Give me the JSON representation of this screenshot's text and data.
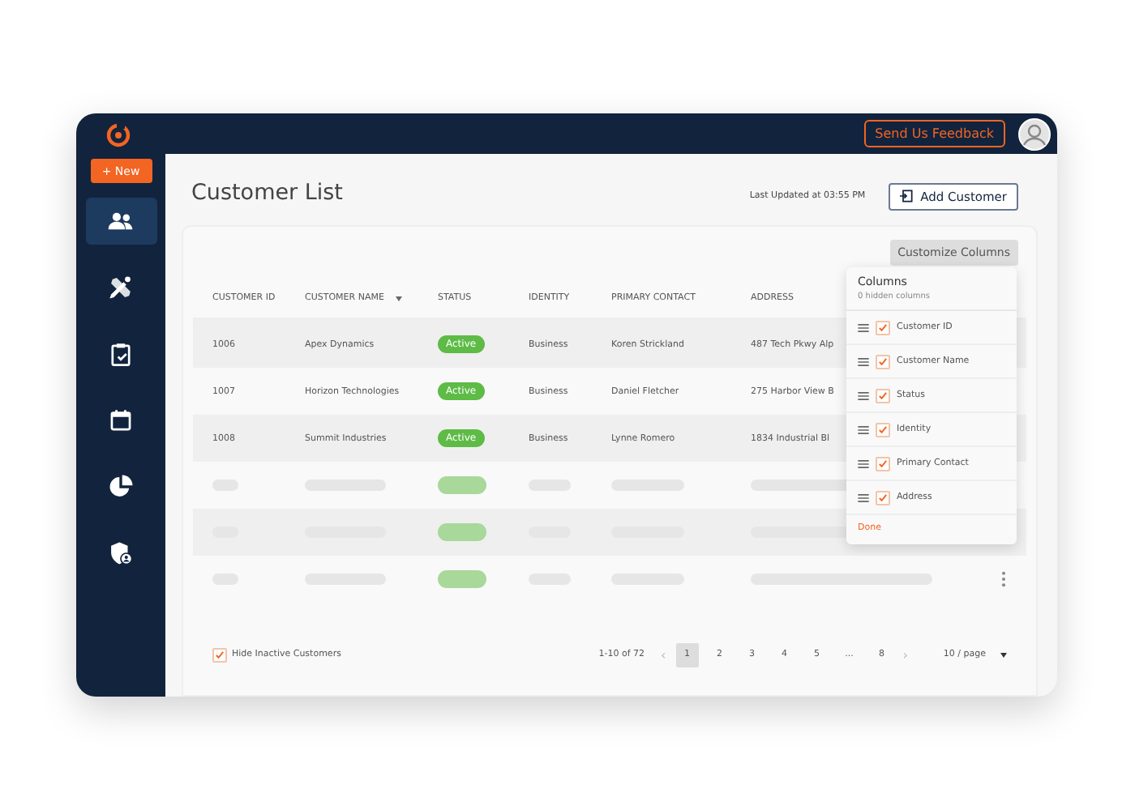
{
  "top_bar": {
    "feedback_button": "Send Us Feedback"
  },
  "sidebar": {
    "new_button": "+ New",
    "items": [
      {
        "kind": "people",
        "selected": true
      },
      {
        "kind": "tools",
        "selected": false
      },
      {
        "kind": "clipboard",
        "selected": false
      },
      {
        "kind": "calendar",
        "selected": false
      },
      {
        "kind": "pie",
        "selected": false
      },
      {
        "kind": "shield",
        "selected": false
      }
    ]
  },
  "page": {
    "title": "Customer List",
    "last_updated": "Last Updated at 03:55 PM",
    "add_button": "Add Customer"
  },
  "table": {
    "customize_button": "Customize Columns",
    "columns": [
      {
        "label": "CUSTOMER ID",
        "sorted": false
      },
      {
        "label": "CUSTOMER NAME",
        "sorted": true
      },
      {
        "label": "STATUS",
        "sorted": false
      },
      {
        "label": "IDENTITY",
        "sorted": false
      },
      {
        "label": "PRIMARY CONTACT",
        "sorted": false
      },
      {
        "label": "ADDRESS",
        "sorted": false
      }
    ],
    "rows": [
      {
        "id": "1006",
        "name": "Apex Dynamics",
        "status": "Active",
        "identity": "Business",
        "contact": "Koren Strickland",
        "address": "487 Tech Pkwy Alp"
      },
      {
        "id": "1007",
        "name": "Horizon Technologies",
        "status": "Active",
        "identity": "Business",
        "contact": "Daniel Fletcher",
        "address": "275 Harbor View B"
      },
      {
        "id": "1008",
        "name": "Summit Industries",
        "status": "Active",
        "identity": "Business",
        "contact": "Lynne Romero",
        "address": "1834 Industrial Bl"
      }
    ],
    "loading_rows": [
      {
        "menu": false
      },
      {
        "menu": false
      },
      {
        "menu": true
      }
    ]
  },
  "columns_popup": {
    "title": "Columns",
    "subtitle": "0 hidden columns",
    "items": [
      {
        "label": "Customer ID",
        "checked": true
      },
      {
        "label": "Customer Name",
        "checked": true
      },
      {
        "label": "Status",
        "checked": true
      },
      {
        "label": "Identity",
        "checked": true
      },
      {
        "label": "Primary Contact",
        "checked": true
      },
      {
        "label": "Address",
        "checked": true
      }
    ],
    "done": "Done"
  },
  "footer": {
    "hide_inactive": {
      "label": "Hide Inactive Customers",
      "checked": true
    },
    "range": "1-10 of 72",
    "prev": "‹",
    "next": "›",
    "pages": [
      {
        "label": "1",
        "selected": true
      },
      {
        "label": "2",
        "selected": false
      },
      {
        "label": "3",
        "selected": false
      },
      {
        "label": "4",
        "selected": false
      },
      {
        "label": "5",
        "selected": false
      },
      {
        "label": "...",
        "selected": false
      },
      {
        "label": "8",
        "selected": false
      }
    ],
    "page_size": "10 / page"
  }
}
